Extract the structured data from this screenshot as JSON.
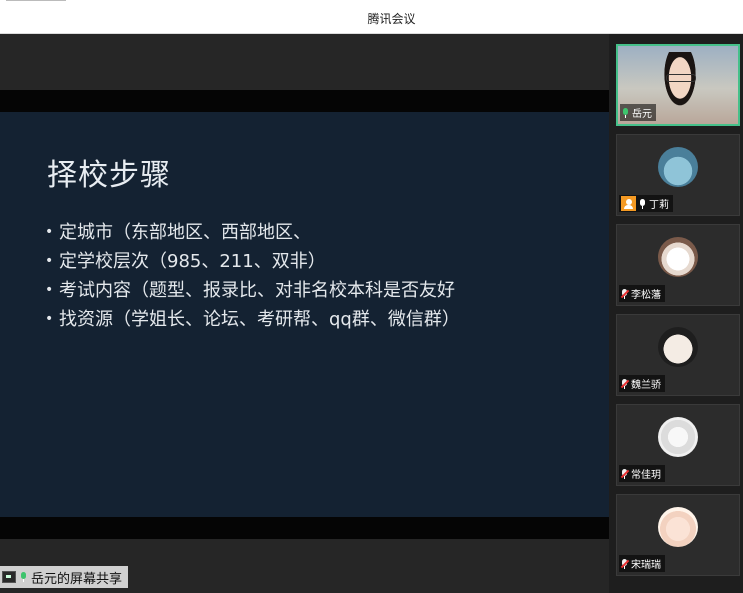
{
  "window": {
    "title": "腾讯会议"
  },
  "slide": {
    "title": "择校步骤",
    "bullets": [
      "定城市（东部地区、西部地区、",
      "定学校层次（985、211、双非）",
      "考试内容（题型、报录比、对非名校本科是否友好",
      "找资源（学姐长、论坛、考研帮、qq群、微信群）"
    ]
  },
  "share_status": {
    "label": "岳元的屏幕共享",
    "icon": "screen-share-icon"
  },
  "participants": [
    {
      "name": "岳元",
      "mic": "on",
      "video": true
    },
    {
      "name": "丁莉",
      "mic": "on",
      "video": false,
      "badge": "user-icon"
    },
    {
      "name": "李松藩",
      "mic": "muted",
      "video": false
    },
    {
      "name": "魏兰骄",
      "mic": "muted",
      "video": false
    },
    {
      "name": "常佳玥",
      "mic": "muted",
      "video": false
    },
    {
      "name": "宋瑞瑞",
      "mic": "muted",
      "video": false
    }
  ],
  "colors": {
    "slide_bg": "#142232",
    "active_border": "#45c08a",
    "mic_on": "#3ec46d",
    "mic_muted": "#e33333"
  }
}
